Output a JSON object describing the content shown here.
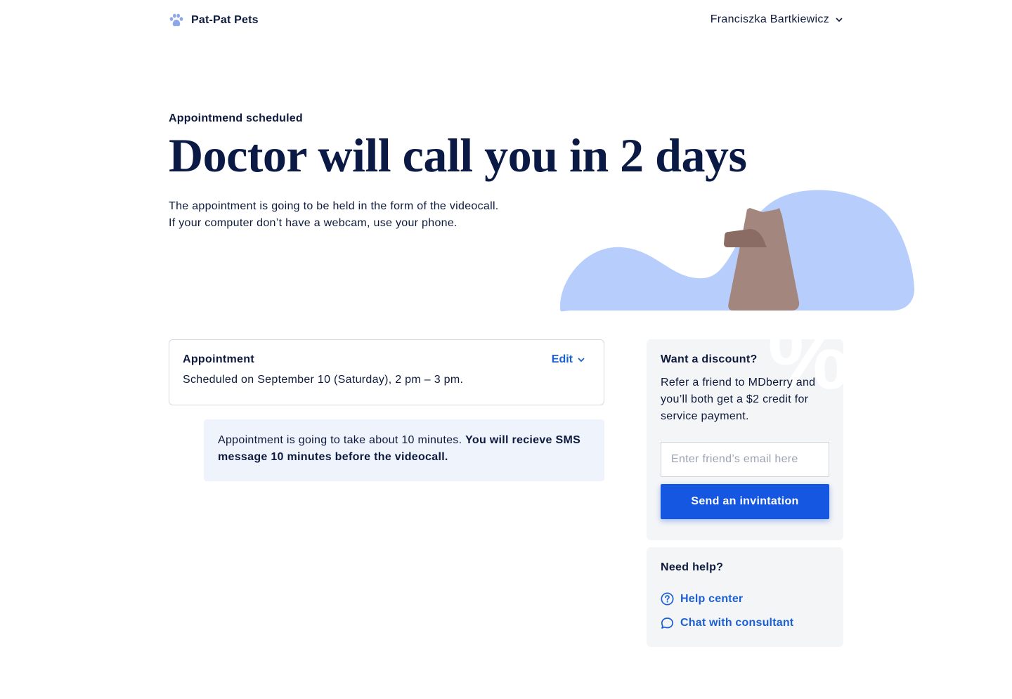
{
  "brand": {
    "name": "Pat-Pat Pets",
    "icon": "paw-icon"
  },
  "user": {
    "name": "Franciszka Bartkiewicz",
    "menu_icon": "chevron-down-icon"
  },
  "hero": {
    "eyebrow": "Appointmend scheduled",
    "title": "Doctor will call you in 2 days",
    "description_line1": "The appointment is going to be held in the form of the videocall.",
    "description_line2": "If your computer don’t have a webcam, use your phone."
  },
  "appointment": {
    "title": "Appointment",
    "edit_label": "Edit",
    "schedule": "Scheduled on September 10 (Saturday), 2 pm – 3 pm."
  },
  "info": {
    "text": "Appointment is going to take about 10 minutes. ",
    "bold": "You will recieve SMS message 10 minutes before the videocall."
  },
  "discount": {
    "title": "Want a discount?",
    "text": "Refer a friend to MDberry and you’ll both get a $2 credit for service payment.",
    "decoration": "%",
    "input_placeholder": "Enter friend’s email here",
    "button_label": "Send an invintation"
  },
  "help": {
    "title": "Need help?",
    "links": [
      {
        "label": "Help center",
        "icon": "question-circle-icon"
      },
      {
        "label": "Chat with consultant",
        "icon": "chat-bubble-icon"
      }
    ]
  },
  "colors": {
    "primary": "#1557e0",
    "link": "#1b5fd6",
    "text": "#0e1a3d",
    "illustration_blue": "#b7cefd",
    "illustration_brown": "#a3877e",
    "info_bg": "#eef3fc",
    "card_bg": "#f4f5f7"
  }
}
